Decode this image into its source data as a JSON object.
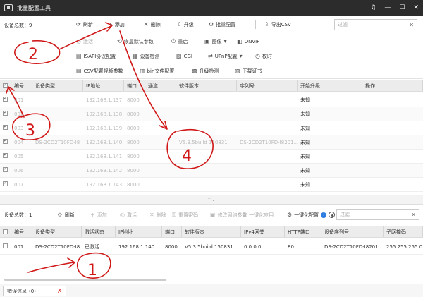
{
  "app": {
    "title": "批量配置工具"
  },
  "toolbar": {
    "device_count": "设备总数：9",
    "refresh": "刷新",
    "add": "添加",
    "delete": "删除",
    "upgrade": "升级",
    "batch_config": "批量配置",
    "export_csv": "导出CSV",
    "filter_placeholder": "过滤",
    "activate": "激活",
    "restore_default": "恢复默认参数",
    "reboot": "重启",
    "image": "图像",
    "onvif": "ONVIF",
    "isapi": "ISAPI协议配置",
    "device_check": "设备检测",
    "cgi": "CGI",
    "upnp": "UPnP配置",
    "time_sync": "校时",
    "csv_video": "CSV配置视频参数",
    "bin_config": "bin文件配置",
    "upgrade_check": "升级检测",
    "download_cert": "下载证书"
  },
  "top_table": {
    "columns": [
      "编号",
      "设备类型",
      "IP地址",
      "端口",
      "通道",
      "软件版本",
      "序列号",
      "开始升级",
      "操作"
    ],
    "rows": [
      {
        "num": "001",
        "type": "",
        "ip": "192.168.1.137",
        "port": "8000",
        "channel": "",
        "version": "",
        "serial": "",
        "status": "未知"
      },
      {
        "num": "002",
        "type": "",
        "ip": "192.168.1.138",
        "port": "8000",
        "channel": "",
        "version": "",
        "serial": "",
        "status": "未知"
      },
      {
        "num": "003",
        "type": "",
        "ip": "192.168.1.139",
        "port": "8000",
        "channel": "",
        "version": "",
        "serial": "",
        "status": "未知"
      },
      {
        "num": "004",
        "type": "DS-2CD2T10FD-I8",
        "ip": "192.168.1.140",
        "port": "8000",
        "channel": "",
        "version": "V5.3.5build 150831",
        "serial": "DS-2CD2T10FD-I8201...",
        "status": "未知"
      },
      {
        "num": "005",
        "type": "",
        "ip": "192.168.1.141",
        "port": "8000",
        "channel": "",
        "version": "",
        "serial": "",
        "status": "未知"
      },
      {
        "num": "006",
        "type": "",
        "ip": "192.168.1.142",
        "port": "8000",
        "channel": "",
        "version": "",
        "serial": "",
        "status": "未知"
      },
      {
        "num": "007",
        "type": "",
        "ip": "192.168.1.143",
        "port": "8000",
        "channel": "",
        "version": "",
        "serial": "",
        "status": "未知"
      }
    ]
  },
  "lower_toolbar": {
    "device_count": "设备总数：1",
    "refresh": "刷新",
    "add": "添加",
    "activate": "激活",
    "delete": "删除",
    "restore": "重置密码",
    "modify_network": "修改网络参数",
    "one_click": "一键化应用",
    "one_click_config": "一键化配置",
    "filter_placeholder": "过滤"
  },
  "bottom_table": {
    "columns": [
      "编号",
      "设备类型",
      "激活状态",
      "IP地址",
      "端口",
      "软件版本",
      "IPv4网关",
      "HTTP端口",
      "设备序列号",
      "子网掩码"
    ],
    "rows": [
      {
        "num": "001",
        "type": "DS-2CD2T10FD-I8",
        "status": "已激活",
        "ip": "192.168.1.140",
        "port": "8000",
        "version": "V5.3.5build 150831",
        "gateway": "0.0.0.0",
        "http": "80",
        "serial": "DS-2CD2T10FD-I8201...",
        "mask": "255.255.255.0"
      }
    ]
  },
  "bottom_bar": {
    "error_tab": "错误信息",
    "error_count": "(0)"
  },
  "annotations": {
    "one": "1",
    "two": "2",
    "three": "3",
    "four": "4"
  },
  "colors": {
    "titlebar": "#2c2c2c",
    "annotation_red": "#d01818",
    "accent": "#2d7de0"
  },
  "icons": [
    "app-icon",
    "bell-icon",
    "minimize-icon",
    "maximize-icon",
    "close-icon",
    "refresh-icon",
    "add-icon",
    "delete-icon",
    "upgrade-icon",
    "settings-icon",
    "export-icon",
    "pin-icon",
    "info-icon"
  ]
}
